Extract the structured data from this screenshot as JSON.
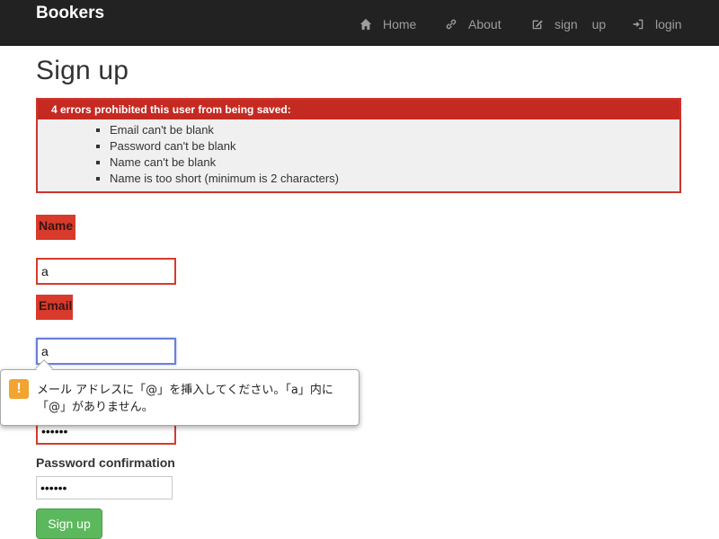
{
  "brand": "Bookers",
  "nav": {
    "home": "Home",
    "about": "About",
    "signup": "sign up",
    "login": "login"
  },
  "page_title": "Sign up",
  "errors": {
    "heading": "4 errors prohibited this user from being saved:",
    "items": [
      "Email can't be blank",
      "Password can't be blank",
      "Name can't be blank",
      "Name is too short (minimum is 2 characters)"
    ]
  },
  "form": {
    "name_label": "Name",
    "name_value": "a",
    "email_label": "Email",
    "email_value": "a",
    "password_value": "••••••",
    "password_confirmation_label": "Password confirmation",
    "password_confirmation_value": "••••••",
    "submit_label": "Sign up"
  },
  "validation_tooltip": {
    "icon": "!",
    "message": "メール アドレスに「@」を挿入してください。「a」内に「@」がありません。"
  },
  "colors": {
    "navbar_bg": "#222222",
    "error_red": "#d83a2c",
    "error_header": "#c52a22",
    "submit_green": "#5cb85c",
    "warning_orange": "#f2a431"
  }
}
